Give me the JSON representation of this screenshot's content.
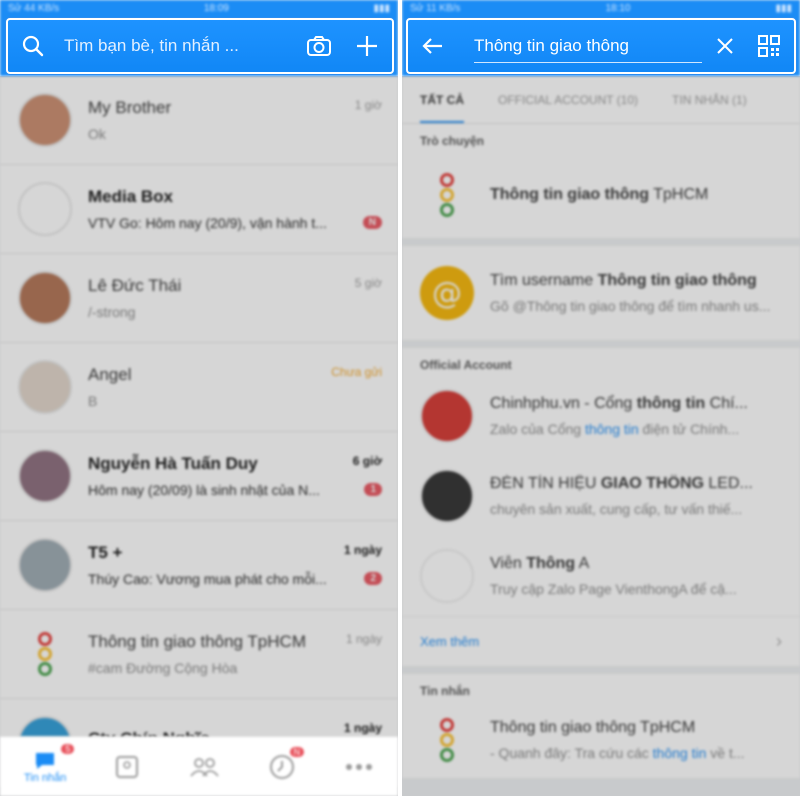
{
  "left": {
    "status": {
      "left": "Sử 44 KB/s",
      "time": "18:09"
    },
    "search_placeholder": "Tìm bạn bè, tin nhắn ...",
    "conversations": [
      {
        "name": "My Brother",
        "preview": "Ok",
        "time": "1 giờ",
        "bold": false,
        "badge": "",
        "avatar_color": "#c98a6b"
      },
      {
        "name": "Media Box",
        "preview": "VTV Go: Hôm nay (20/9), vận hành t...",
        "time": "",
        "bold": true,
        "badge": "N",
        "avatar_color": "#ffffff"
      },
      {
        "name": "Lê Đức Thái",
        "preview": "/-strong",
        "time": "5 giờ",
        "bold": false,
        "badge": "",
        "avatar_color": "#b07050"
      },
      {
        "name": "Angel",
        "preview": "B",
        "time": "Chưa gửi",
        "bold": false,
        "badge": "",
        "avatar_color": "#e0d4c8"
      },
      {
        "name": "Nguyễn Hà Tuấn Duy",
        "preview": "Hôm nay (20/09) là sinh nhật của N...",
        "time": "6 giờ",
        "bold": true,
        "badge": "1",
        "avatar_color": "#8a6a7a"
      },
      {
        "name": "T5 +",
        "preview": "Thúy Cao: Vương mua phát cho mỗi...",
        "time": "1 ngày",
        "bold": true,
        "badge": "2",
        "avatar_color": "#9aa8b0"
      },
      {
        "name": "Thông tin giao thông TpHCM",
        "preview": "#cam Đường Cộng Hòa",
        "time": "1 ngày",
        "bold": false,
        "badge": "",
        "avatar_color": "traffic"
      },
      {
        "name": "Cty Chín Nghĩa",
        "preview": "",
        "time": "1 ngày",
        "bold": true,
        "badge": "",
        "avatar_color": "#2a9bd8"
      }
    ],
    "nav": {
      "messages_label": "Tin nhắn",
      "messages_badge": "5",
      "timeline_badge": "N"
    }
  },
  "right": {
    "status": {
      "left": "Sử 11 KB/s",
      "time": "18:10"
    },
    "query": "Thông tin giao thông",
    "tabs": {
      "all": "TẤT CẢ",
      "official": "OFFICIAL ACCOUNT (10)",
      "messages": "TIN NHẮN (1)"
    },
    "chat_section": {
      "title": "Trò chuyện",
      "item": {
        "name_bold": "Thông tin giao thông",
        "name_rest": " TpHCM"
      }
    },
    "username": {
      "prefix": "Tìm username ",
      "bold": "Thông tin giao thông",
      "hint": "Gõ @Thông tin giao thông để tìm nhanh us..."
    },
    "official_section": {
      "title": "Official Account",
      "items": [
        {
          "name_pre": "Chinhphu.vn - Cổng ",
          "name_bold": "thông tin",
          "name_post": " Chí...",
          "sub_pre": "Zalo của Cổng ",
          "sub_hl": "thông tin",
          "sub_post": " điện tử Chính...",
          "avatar_color": "#d4322c"
        },
        {
          "name_pre": "ĐÈN TÍN HIỆU ",
          "name_bold": "GIAO THÔNG",
          "name_post": " LED...",
          "sub_pre": "chuyên sản xuất, cung cấp, tư vấn thiế...",
          "sub_hl": "",
          "sub_post": "",
          "avatar_color": "#2b2b2b"
        },
        {
          "name_pre": "Viễn ",
          "name_bold": "Thông",
          "name_post": " A",
          "sub_pre": "Truy cập Zalo Page VienthongA để cậ...",
          "sub_hl": "",
          "sub_post": "",
          "avatar_color": "#ffffff"
        }
      ],
      "more": "Xem thêm"
    },
    "message_section": {
      "title": "Tin nhắn",
      "item": {
        "name": "Thông tin giao thông TpHCM",
        "sub_pre": "- Quanh đây: Tra cứu các ",
        "sub_hl": "thông tin",
        "sub_post": " về t..."
      }
    }
  }
}
